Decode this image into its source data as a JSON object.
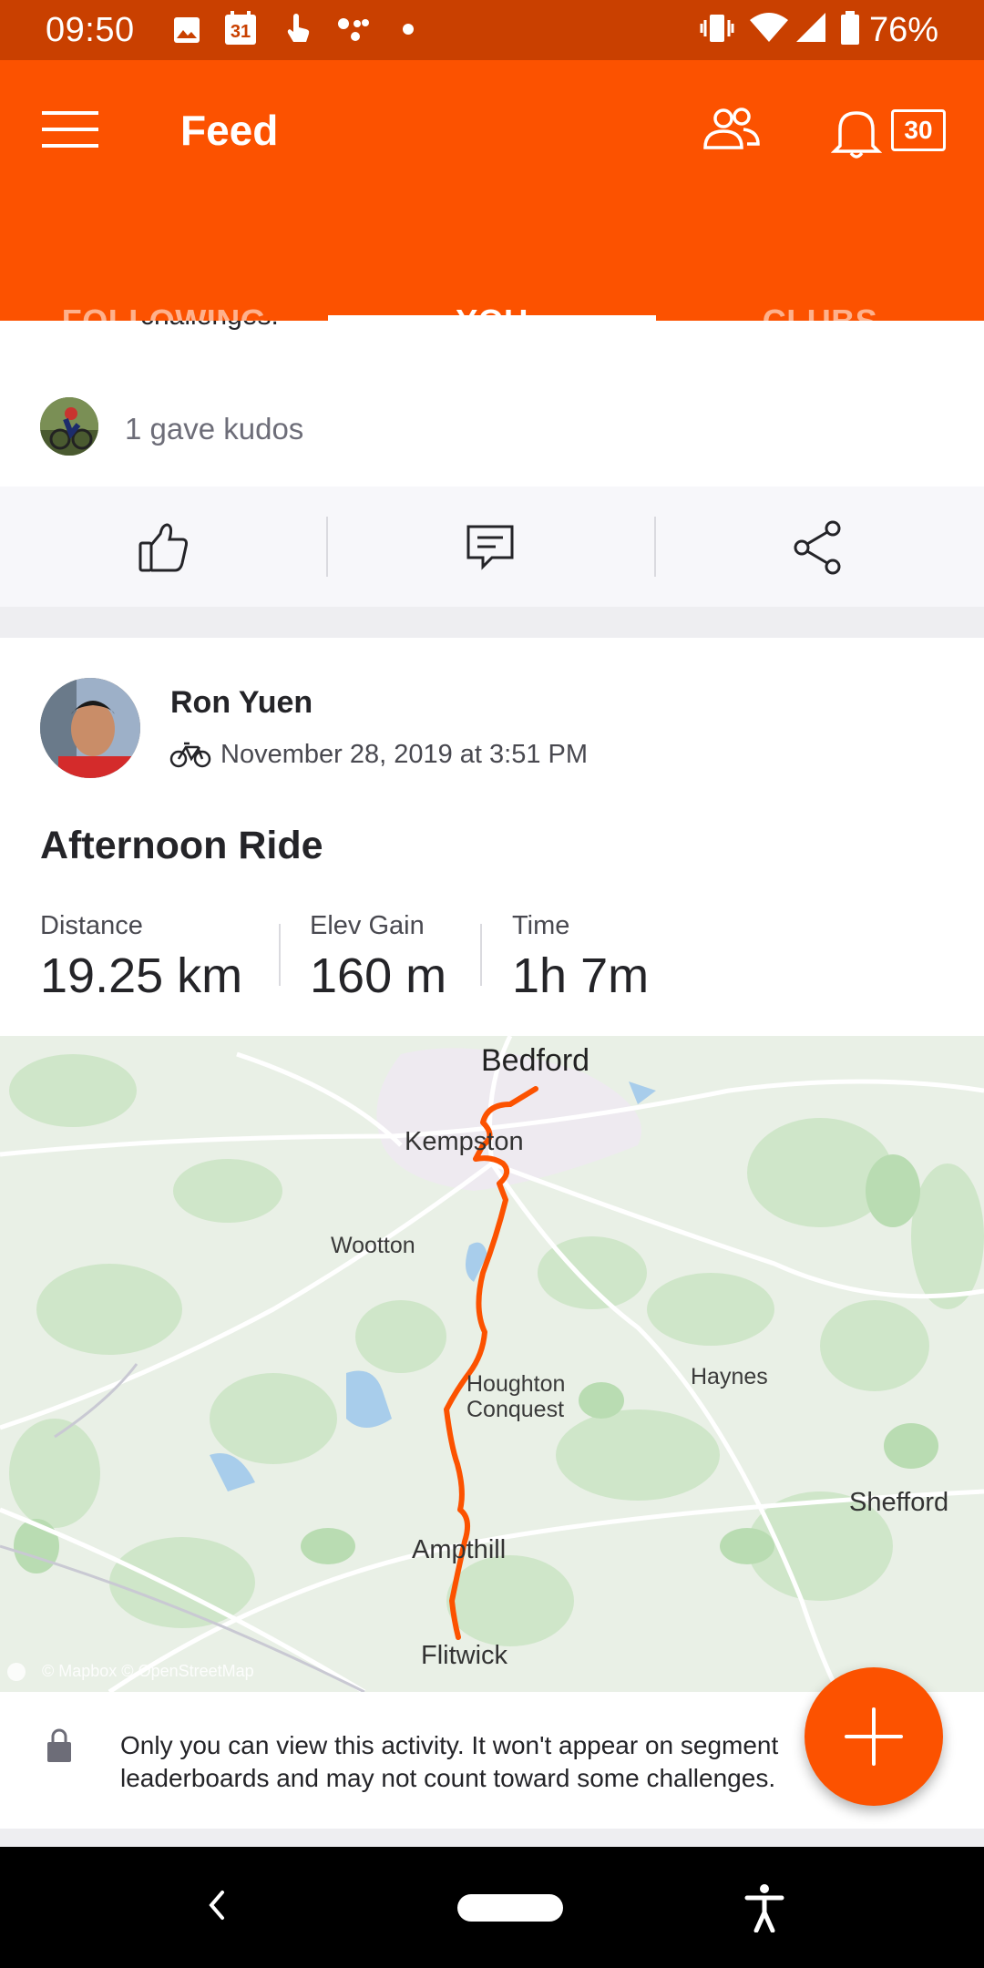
{
  "status_bar": {
    "time": "09:50",
    "calendar_day": "31",
    "battery": "76%"
  },
  "app_bar": {
    "title": "Feed",
    "notification_count": "30"
  },
  "tabs": [
    {
      "label": "FOLLOWING",
      "active": false
    },
    {
      "label": "YOU",
      "active": true
    },
    {
      "label": "CLUBS",
      "active": false
    }
  ],
  "prev_post": {
    "clipped_text": "challenges.",
    "kudos_text": "1 gave kudos"
  },
  "activity": {
    "athlete_name": "Ron Yuen",
    "date": "November 28, 2019 at 3:51 PM",
    "title": "Afternoon Ride",
    "stats": [
      {
        "label": "Distance",
        "value": "19.25 km"
      },
      {
        "label": "Elev Gain",
        "value": "160 m"
      },
      {
        "label": "Time",
        "value": "1h 7m"
      }
    ],
    "map": {
      "places": [
        "Bedford",
        "Kempston",
        "Wootton",
        "Houghton",
        "Conquest",
        "Haynes",
        "Shefford",
        "Ampthill",
        "Flitwick"
      ],
      "attribution": "© Mapbox © OpenStreetMap"
    },
    "privacy_notice": "Only you can view this activity. It won't appear on segment leaderboards and may not count toward some challenges."
  },
  "colors": {
    "brand": "#fc5200",
    "status_bar": "#c94000",
    "route": "#fc5200"
  }
}
